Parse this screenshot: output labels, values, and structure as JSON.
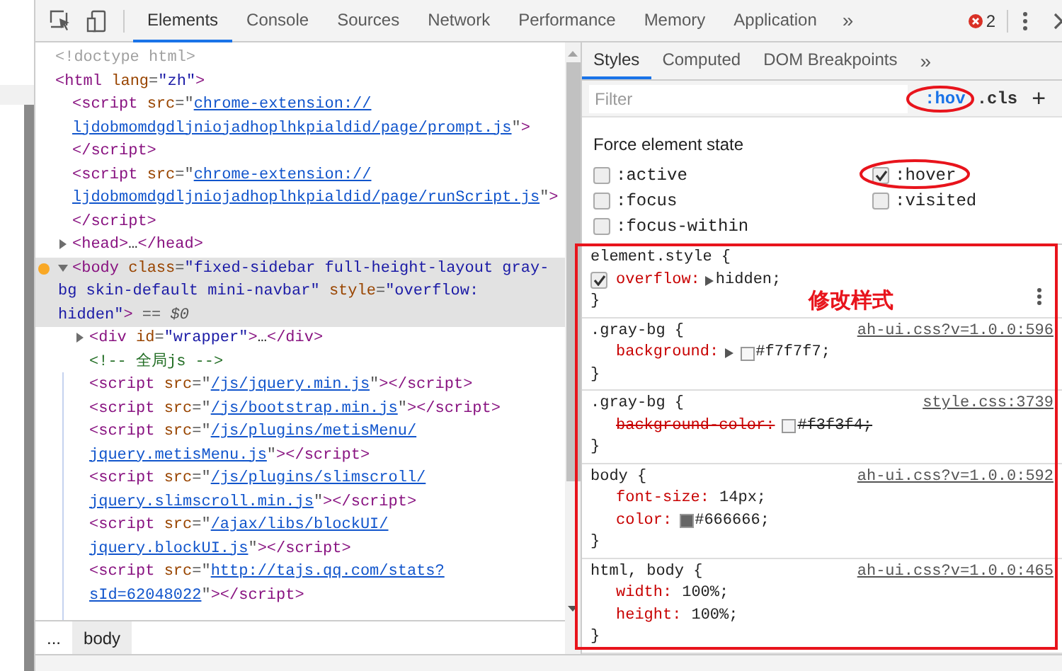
{
  "toolbar": {
    "tabs": [
      {
        "label": "Elements",
        "selected": true
      },
      {
        "label": "Console",
        "selected": false
      },
      {
        "label": "Sources",
        "selected": false
      },
      {
        "label": "Network",
        "selected": false
      },
      {
        "label": "Performance",
        "selected": false
      },
      {
        "label": "Memory",
        "selected": false
      },
      {
        "label": "Application",
        "selected": false
      }
    ],
    "more": "»",
    "error_count": "2"
  },
  "dom_tree": [
    {
      "selected": false,
      "lines": [
        [
          {
            "kind": "doctype",
            "text": "<!doctype html>"
          }
        ]
      ]
    },
    {
      "selected": false,
      "lines": [
        [
          {
            "kind": "tag",
            "text": "<html"
          },
          {
            "kind": "attr",
            "text": " lang"
          },
          {
            "kind": "punct",
            "text": "="
          },
          {
            "kind": "value",
            "text": "\"zh\""
          },
          {
            "kind": "tag",
            "text": ">"
          }
        ]
      ],
      "children": [
        {
          "selected": false,
          "lines": [
            [
              {
                "kind": "tag",
                "text": "<script"
              },
              {
                "kind": "attr",
                "text": " src"
              },
              {
                "kind": "punct",
                "text": "=\""
              },
              {
                "kind": "link",
                "text": "chrome-extension://"
              }
            ],
            [
              {
                "kind": "link",
                "text": "ljdobmomdgdljniojadhoplhkpialdid/page/prompt.js"
              },
              {
                "kind": "punct",
                "text": "\""
              },
              {
                "kind": "tag",
                "text": ">"
              }
            ],
            [
              {
                "kind": "tag",
                "text": "</script>"
              }
            ]
          ]
        },
        {
          "selected": false,
          "lines": [
            [
              {
                "kind": "tag",
                "text": "<script"
              },
              {
                "kind": "attr",
                "text": " src"
              },
              {
                "kind": "punct",
                "text": "=\""
              },
              {
                "kind": "link",
                "text": "chrome-extension://"
              }
            ],
            [
              {
                "kind": "link",
                "text": "ljdobmomdgdljniojadhoplhkpialdid/page/runScript.js"
              },
              {
                "kind": "punct",
                "text": "\""
              },
              {
                "kind": "tag",
                "text": ">"
              }
            ],
            [
              {
                "kind": "tag",
                "text": "</script>"
              }
            ]
          ]
        },
        {
          "selected": false,
          "expanded": false,
          "lines": [
            [
              {
                "kind": "tag",
                "text": "<head>"
              },
              {
                "kind": "text",
                "text": "…"
              },
              {
                "kind": "tag",
                "text": "</head>"
              }
            ]
          ]
        },
        {
          "selected": true,
          "expanded": true,
          "lines": [
            [
              {
                "kind": "tag",
                "text": "<body"
              },
              {
                "kind": "attr",
                "text": " class"
              },
              {
                "kind": "punct",
                "text": "="
              },
              {
                "kind": "value",
                "text": "\"fixed-sidebar full-height-layout gray-"
              }
            ],
            [
              {
                "kind": "value",
                "text": "bg skin-default mini-navbar\""
              },
              {
                "kind": "attr",
                "text": " style"
              },
              {
                "kind": "punct",
                "text": "="
              },
              {
                "kind": "value",
                "text": "\"overflow:"
              }
            ],
            [
              {
                "kind": "value",
                "text": "hidden\""
              },
              {
                "kind": "tag",
                "text": ">"
              },
              {
                "kind": "dim",
                "text": " == "
              },
              {
                "kind": "var",
                "text": "$0"
              }
            ]
          ],
          "children": [
            {
              "selected": false,
              "expanded": false,
              "lines": [
                [
                  {
                    "kind": "tag",
                    "text": "<div"
                  },
                  {
                    "kind": "attr",
                    "text": " id"
                  },
                  {
                    "kind": "punct",
                    "text": "="
                  },
                  {
                    "kind": "value",
                    "text": "\"wrapper\""
                  },
                  {
                    "kind": "tag",
                    "text": ">"
                  },
                  {
                    "kind": "text",
                    "text": "…"
                  },
                  {
                    "kind": "tag",
                    "text": "</div>"
                  }
                ]
              ]
            },
            {
              "selected": false,
              "lines": [
                [
                  {
                    "kind": "comment",
                    "text": "<!-- 全局js -->"
                  }
                ]
              ]
            },
            {
              "selected": false,
              "lines": [
                [
                  {
                    "kind": "tag",
                    "text": "<script"
                  },
                  {
                    "kind": "attr",
                    "text": " src"
                  },
                  {
                    "kind": "punct",
                    "text": "=\""
                  },
                  {
                    "kind": "link",
                    "text": "/js/jquery.min.js"
                  },
                  {
                    "kind": "punct",
                    "text": "\""
                  },
                  {
                    "kind": "tag",
                    "text": "></script>"
                  }
                ]
              ]
            },
            {
              "selected": false,
              "lines": [
                [
                  {
                    "kind": "tag",
                    "text": "<script"
                  },
                  {
                    "kind": "attr",
                    "text": " src"
                  },
                  {
                    "kind": "punct",
                    "text": "=\""
                  },
                  {
                    "kind": "link",
                    "text": "/js/bootstrap.min.js"
                  },
                  {
                    "kind": "punct",
                    "text": "\""
                  },
                  {
                    "kind": "tag",
                    "text": "></script>"
                  }
                ]
              ]
            },
            {
              "selected": false,
              "lines": [
                [
                  {
                    "kind": "tag",
                    "text": "<script"
                  },
                  {
                    "kind": "attr",
                    "text": " src"
                  },
                  {
                    "kind": "punct",
                    "text": "=\""
                  },
                  {
                    "kind": "link",
                    "text": "/js/plugins/metisMenu/"
                  }
                ],
                [
                  {
                    "kind": "link",
                    "text": "jquery.metisMenu.js"
                  },
                  {
                    "kind": "punct",
                    "text": "\""
                  },
                  {
                    "kind": "tag",
                    "text": "></script>"
                  }
                ]
              ]
            },
            {
              "selected": false,
              "lines": [
                [
                  {
                    "kind": "tag",
                    "text": "<script"
                  },
                  {
                    "kind": "attr",
                    "text": " src"
                  },
                  {
                    "kind": "punct",
                    "text": "=\""
                  },
                  {
                    "kind": "link",
                    "text": "/js/plugins/slimscroll/"
                  }
                ],
                [
                  {
                    "kind": "link",
                    "text": "jquery.slimscroll.min.js"
                  },
                  {
                    "kind": "punct",
                    "text": "\""
                  },
                  {
                    "kind": "tag",
                    "text": "></script>"
                  }
                ]
              ]
            },
            {
              "selected": false,
              "lines": [
                [
                  {
                    "kind": "tag",
                    "text": "<script"
                  },
                  {
                    "kind": "attr",
                    "text": " src"
                  },
                  {
                    "kind": "punct",
                    "text": "=\""
                  },
                  {
                    "kind": "link",
                    "text": "/ajax/libs/blockUI/"
                  }
                ],
                [
                  {
                    "kind": "link",
                    "text": "jquery.blockUI.js"
                  },
                  {
                    "kind": "punct",
                    "text": "\""
                  },
                  {
                    "kind": "tag",
                    "text": "></script>"
                  }
                ]
              ]
            },
            {
              "selected": false,
              "lines": [
                [
                  {
                    "kind": "tag",
                    "text": "<script"
                  },
                  {
                    "kind": "attr",
                    "text": " src"
                  },
                  {
                    "kind": "punct",
                    "text": "=\""
                  },
                  {
                    "kind": "link",
                    "text": "http://tajs.qq.com/stats?"
                  }
                ],
                [
                  {
                    "kind": "link",
                    "text": "sId=62048022"
                  },
                  {
                    "kind": "punct",
                    "text": "\""
                  },
                  {
                    "kind": "tag",
                    "text": "></script>"
                  }
                ]
              ]
            }
          ]
        }
      ]
    }
  ],
  "breadcrumbs": [
    {
      "label": "...",
      "selected": false
    },
    {
      "label": "body",
      "selected": true
    }
  ],
  "styles_tabs": [
    {
      "label": "Styles",
      "selected": true
    },
    {
      "label": "Computed",
      "selected": false
    },
    {
      "label": "DOM Breakpoints",
      "selected": false
    }
  ],
  "styles_more": "»",
  "filter": {
    "placeholder": "Filter",
    "hov": ":hov",
    "hov_circled": true,
    "cls": ".cls",
    "add": "+"
  },
  "force_state": {
    "title": "Force element state",
    "states": [
      {
        "label": ":active",
        "checked": false,
        "circled": false
      },
      {
        "label": ":hover",
        "checked": true,
        "circled": true
      },
      {
        "label": ":focus",
        "checked": false,
        "circled": false
      },
      {
        "label": ":visited",
        "checked": false,
        "circled": false
      },
      {
        "label": ":focus-within",
        "checked": false,
        "circled": false
      }
    ]
  },
  "rules_highlighted": true,
  "annotation": "修改样式",
  "rules": [
    {
      "selector": "element.style {",
      "menu": true,
      "close": "}",
      "declarations": [
        {
          "property": "overflow:",
          "value": "hidden;",
          "checked": true,
          "expandable": true,
          "overridden": false
        }
      ]
    },
    {
      "selector": ".gray-bg {",
      "source": "ah-ui.css?v=1.0.0:596",
      "close": "}",
      "declarations": [
        {
          "property": "background:",
          "value": "#f7f7f7;",
          "expandable": true,
          "color": "#f7f7f7",
          "overridden": false
        }
      ]
    },
    {
      "selector": ".gray-bg {",
      "source": "style.css:3739",
      "close": "}",
      "declarations": [
        {
          "property": "background-color:",
          "value": "#f3f3f4;",
          "expandable": false,
          "color": "#f3f3f4",
          "overridden": true
        }
      ]
    },
    {
      "selector": "body {",
      "source": "ah-ui.css?v=1.0.0:592",
      "close": "}",
      "declarations": [
        {
          "property": "font-size:",
          "value": "14px;",
          "expandable": false,
          "overridden": false
        },
        {
          "property": "color:",
          "value": "#666666;",
          "expandable": false,
          "color": "#666666",
          "overridden": false
        }
      ]
    },
    {
      "selector": "html, body {",
      "source": "ah-ui.css?v=1.0.0:465",
      "close": "}",
      "declarations": [
        {
          "property": "width:",
          "value": "100%;",
          "expandable": false,
          "overridden": false
        },
        {
          "property": "height:",
          "value": "100%;",
          "expandable": false,
          "overridden": false
        }
      ]
    }
  ]
}
